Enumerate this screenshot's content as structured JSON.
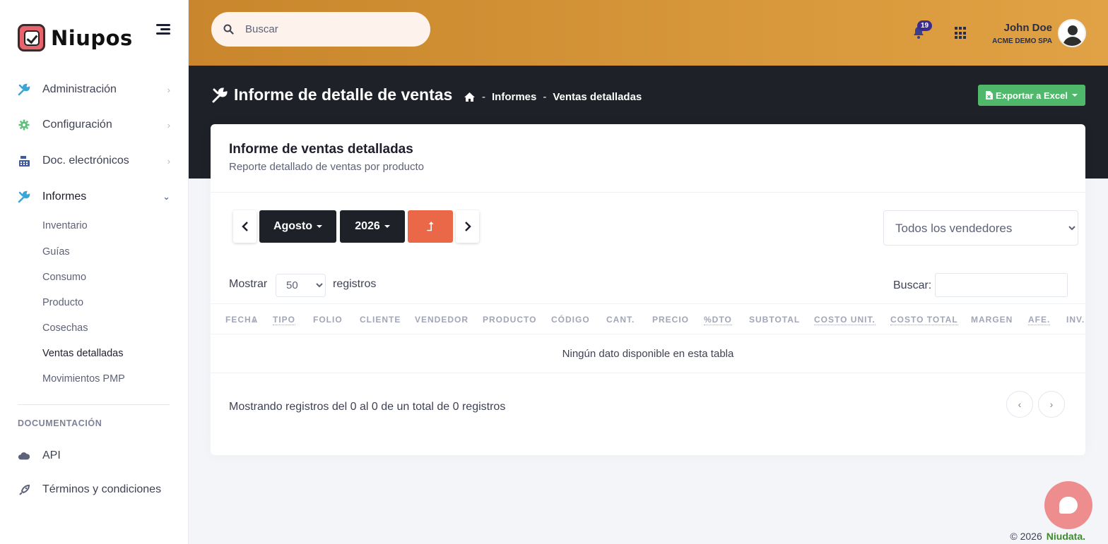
{
  "brand": {
    "name": "Niupos",
    "accent": "#e8646c"
  },
  "sidebar": {
    "items": [
      {
        "label": "Administración",
        "icon": "tools-icon"
      },
      {
        "label": "Configuración",
        "icon": "gear-icon"
      },
      {
        "label": "Doc. electrónicos",
        "icon": "cash-register-icon"
      },
      {
        "label": "Informes",
        "icon": "tools-icon",
        "expanded": true
      }
    ],
    "sub_items": [
      "Inventario",
      "Guías",
      "Consumo",
      "Producto",
      "Cosechas",
      "Ventas detalladas",
      "Movimientos PMP"
    ],
    "active_sub": "Ventas detalladas",
    "section_title": "DOCUMENTACIÓN",
    "doc_items": [
      {
        "label": "API",
        "icon": "cloud-icon"
      },
      {
        "label": "Términos y condiciones",
        "icon": "rocket-icon"
      }
    ]
  },
  "header": {
    "search_placeholder": "Buscar",
    "notifications_count": "19",
    "user_name": "John Doe",
    "user_company": "ACME DEMO SPA",
    "gradient_start": "#c9862c",
    "gradient_end": "#e0a244"
  },
  "toolbar": {
    "title": "Informe de detalle de ventas",
    "breadcrumb": [
      "Informes",
      "Ventas detalladas"
    ],
    "export_label": "Exportar a Excel",
    "export_color": "#50b86b"
  },
  "card": {
    "title": "Informe de ventas detalladas",
    "subtitle": "Reporte detallado de ventas por producto",
    "month": "Agosto",
    "year": "2026",
    "seller_select": "Todos los vendedores",
    "show_label": "Mostrar",
    "page_length": "50",
    "records_label": "registros",
    "search_label": "Buscar:",
    "search_value": "",
    "columns": [
      "FECHA",
      "TIPO",
      "FOLIO",
      "CLIENTE",
      "VENDEDOR",
      "PRODUCTO",
      "CÓDIGO",
      "CANT.",
      "PRECIO",
      "%DTO",
      "SUBTOTAL",
      "COSTO UNIT.",
      "COSTO TOTAL",
      "MARGEN",
      "AFE.",
      "INV."
    ],
    "empty_message": "Ningún dato disponible en esta tabla",
    "info_text": "Mostrando registros del 0 al 0 de un total de 0 registros"
  },
  "footer": {
    "copyright": "© 2026",
    "company": "Niudata."
  }
}
